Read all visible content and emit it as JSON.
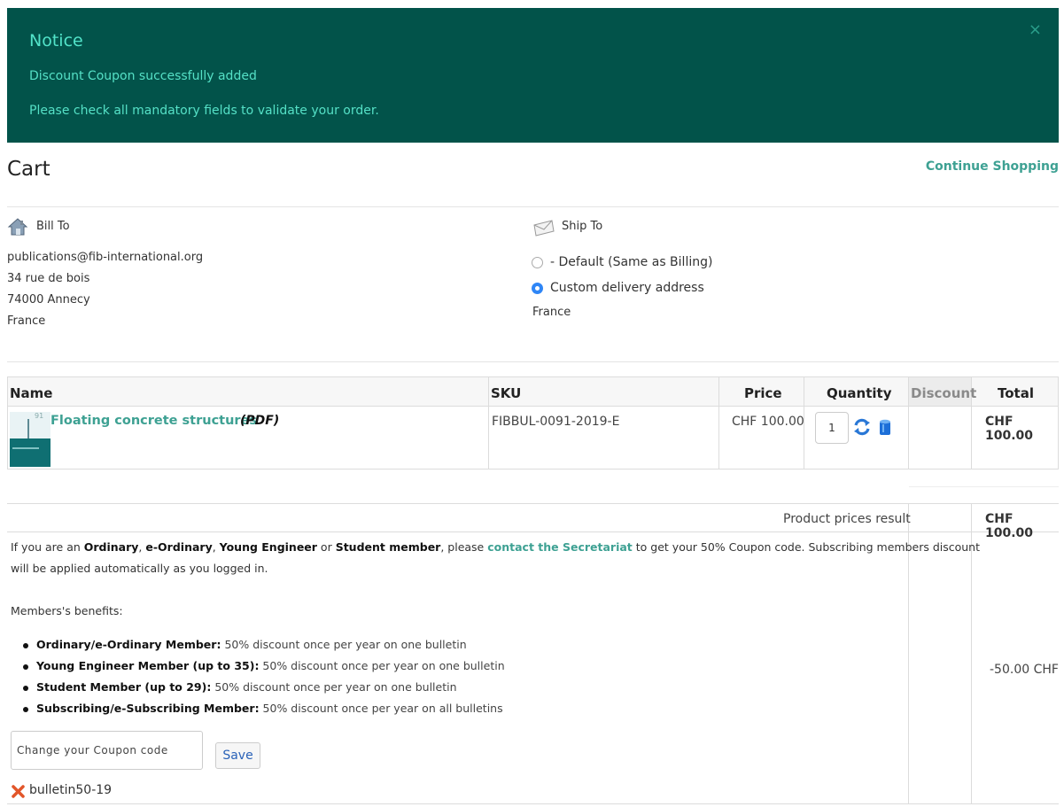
{
  "notice": {
    "title": "Notice",
    "messages": [
      "Discount Coupon successfully added",
      "Please check all mandatory fields to validate your order."
    ],
    "close": "×"
  },
  "page": {
    "title": "Cart",
    "continue": "Continue Shopping"
  },
  "bill_to": {
    "label": "Bill To",
    "lines": [
      "publications@fib-international.org",
      "34 rue de bois",
      "74000 Annecy",
      "France"
    ]
  },
  "ship_to": {
    "label": "Ship To",
    "options": [
      "- Default (Same as Billing)",
      "Custom delivery address"
    ],
    "selected_index": 1,
    "country": "France"
  },
  "table": {
    "headers": {
      "name": "Name",
      "sku": "SKU",
      "price": "Price",
      "quantity": "Quantity",
      "discount": "Discount",
      "total": "Total"
    },
    "item": {
      "name": "Floating concrete structures",
      "type": "(PDF)",
      "sku": "FIBBUL-0091-2019-E",
      "price": "CHF 100.00",
      "quantity": "1",
      "total": "CHF 100.00",
      "thumb_number": "91"
    },
    "result_label": "Product prices result",
    "result_total": "CHF 100.00",
    "coupon_discount": "-50.00 CHF"
  },
  "info": {
    "p1": {
      "prefix": "If you are an ",
      "m1": "Ordinary",
      "s1": ", ",
      "m2": "e-Ordinary",
      "s2": ", ",
      "m3": "Young Engineer",
      "s3": " or ",
      "m4": "Student member",
      "s4": ", please ",
      "link": "contact the Secretariat",
      "s5": " to get your 50% Coupon code. Subscribing members discount",
      "line2": "will be applied automatically as you logged in."
    },
    "benefits_title": "Members's benefits:",
    "benefits": [
      {
        "label": "Ordinary/e-Ordinary Member:",
        "text": " 50% discount once per year on one bulletin"
      },
      {
        "label": "Young Engineer Member (up to 35):",
        "text": " 50% discount once per year on one bulletin"
      },
      {
        "label": "Student Member (up to 29):",
        "text": " 50% discount once per year on one bulletin"
      },
      {
        "label": "Subscribing/e-Subscribing Member:",
        "text": " 50% discount once per year on all bulletins"
      }
    ]
  },
  "coupon": {
    "placeholder": "Change your Coupon code",
    "save": "Save",
    "applied_code": "bulletin50-19"
  },
  "colors": {
    "notice_bg": "#02534a",
    "notice_text": "#4ee0c7",
    "link": "#3ea193",
    "radio": "#2f86f6"
  },
  "icons": {
    "bill": "house-icon",
    "ship": "envelope-icon",
    "refresh": "refresh-icon",
    "trash": "trash-icon",
    "remove": "remove-x-icon"
  }
}
